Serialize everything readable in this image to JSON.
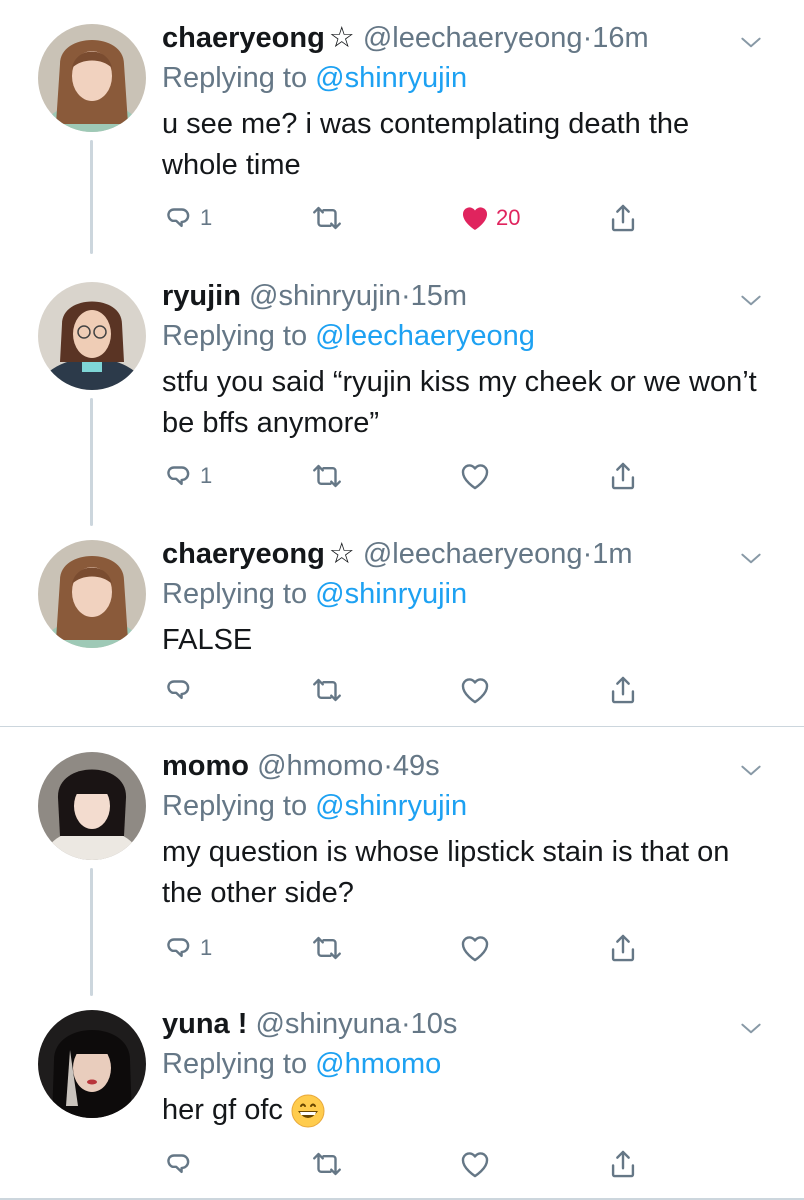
{
  "tweets": [
    {
      "name": "chaeryeong",
      "star": "☆",
      "handle": "@leechaeryeong",
      "dot": "·",
      "time": "16m",
      "reply_prefix": "Replying to ",
      "reply_to": "@shinryujin",
      "text": "u see me? i was contemplating death the whole time",
      "reply_count": "1",
      "like_count": "20",
      "liked": true
    },
    {
      "name": "ryujin",
      "handle": "@shinryujin",
      "dot": "·",
      "time": "15m",
      "reply_prefix": "Replying to ",
      "reply_to": "@leechaeryeong",
      "text": "stfu you said “ryujin kiss my cheek or we won’t be bffs anymore”",
      "reply_count": "1",
      "like_count": "",
      "liked": false
    },
    {
      "name": "chaeryeong",
      "star": "☆",
      "handle": "@leechaeryeong",
      "dot": "·",
      "time": "1m",
      "reply_prefix": "Replying to ",
      "reply_to": "@shinryujin",
      "text": "FALSE",
      "reply_count": "",
      "like_count": "",
      "liked": false
    },
    {
      "name": "momo",
      "handle": "@hmomo",
      "dot": "·",
      "time": "49s",
      "reply_prefix": "Replying to ",
      "reply_to": "@shinryujin",
      "text": "my question is whose lipstick stain is that on the other side?",
      "reply_count": "1",
      "like_count": "",
      "liked": false
    },
    {
      "name": "yuna !",
      "handle": "@shinyuna",
      "dot": "·",
      "time": "10s",
      "reply_prefix": "Replying to ",
      "reply_to": "@hmomo",
      "text": "her gf ofc",
      "emoji": "grinning-face-emoji",
      "reply_count": "",
      "like_count": "",
      "liked": false
    }
  ],
  "colors": {
    "text": "#14171a",
    "secondary": "#657786",
    "link": "#1da1f2",
    "like": "#e0245e",
    "divider": "#ccd6dd"
  },
  "icons": [
    "reply-icon",
    "retweet-icon",
    "like-icon",
    "share-icon",
    "chevron-down-icon",
    "grinning-face-emoji"
  ]
}
